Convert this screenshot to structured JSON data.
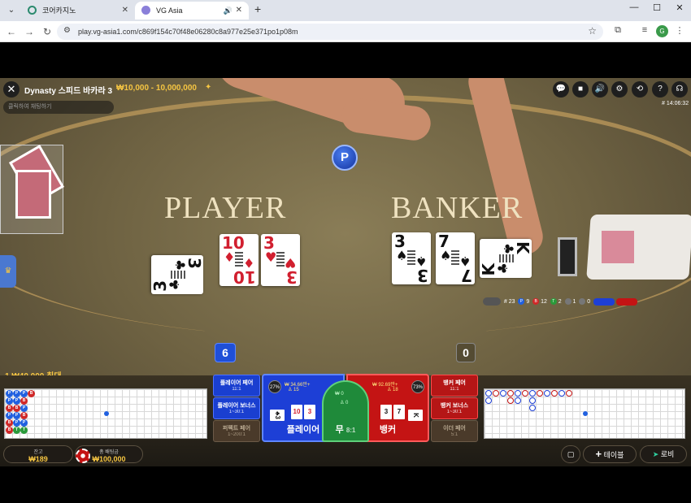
{
  "browser": {
    "tabs": [
      {
        "title": "코어카지노"
      },
      {
        "title": "VG Asia"
      }
    ],
    "url": "play.vg-asia1.com/c869f154c70f48e06280c8a977e25e371po1p08m",
    "profile_initial": "G"
  },
  "game": {
    "table_name": "Dynasty 스피드 바카라 3",
    "table_limit": "₩10,000 - 10,000,000",
    "clock": "# 14:06:32",
    "chat_placeholder": "클릭하여 채팅하기",
    "marker": "P",
    "player_label": "PLAYER",
    "banker_label": "BANKER",
    "player_score": "6",
    "banker_score": "0",
    "bet_limit_text": "1 ₩40,000 최대",
    "player_cards": [
      {
        "rank": "3",
        "suit": "♣",
        "color": "black"
      },
      {
        "rank": "10",
        "suit": "♦",
        "color": "red"
      },
      {
        "rank": "3",
        "suit": "♥",
        "color": "red"
      }
    ],
    "banker_cards": [
      {
        "rank": "3",
        "suit": "♠",
        "color": "black"
      },
      {
        "rank": "7",
        "suit": "♠",
        "color": "black"
      },
      {
        "rank": "K",
        "suit": "♣",
        "color": "black"
      }
    ]
  },
  "bets": {
    "player_pair": {
      "label": "플레이어 페어",
      "odds": "11:1"
    },
    "player_bonus": {
      "label": "플레이어 보너스",
      "odds": "1~30:1"
    },
    "perfect_pair": {
      "label": "퍼펙트 페어",
      "odds": "1~200:1"
    },
    "banker_pair": {
      "label": "뱅커 페어",
      "odds": "11:1"
    },
    "banker_bonus": {
      "label": "뱅커 보너스",
      "odds": "1~30:1"
    },
    "either_pair": {
      "label": "이더 페어",
      "odds": "5:1"
    },
    "player": {
      "label": "플레이어",
      "total": "₩ 34.66만+",
      "count": "15",
      "pct": "27%"
    },
    "tie": {
      "label": "무",
      "odds": "8:1",
      "total": "₩ 0",
      "count": "0"
    },
    "banker": {
      "label": "뱅커",
      "total": "₩ 92.69만+",
      "count": "18",
      "pct": "73%"
    }
  },
  "stats": {
    "rounds": "# 23",
    "player_wins": "9",
    "banker_wins": "12",
    "ties": "2",
    "player_pairs": "1",
    "banker_pairs": "0"
  },
  "footer": {
    "balance_label": "잔고",
    "balance": "₩189",
    "total_bet_label": "총 배팅금",
    "total_bet": "₩100,000",
    "tables_button": "테이블",
    "lobby_button": "로비"
  },
  "bead_road": [
    [
      "P",
      "P",
      "B",
      "P",
      "B",
      "B"
    ],
    [
      "P",
      "P",
      "B",
      "P",
      "P",
      "T"
    ],
    [
      "P",
      "B",
      "P",
      "B",
      "P",
      "T"
    ],
    [
      "B"
    ]
  ],
  "colors": {
    "player": "#1d3fd6",
    "banker": "#c41414",
    "tie": "#1f8a3a",
    "accent_gold": "#f5c542"
  }
}
